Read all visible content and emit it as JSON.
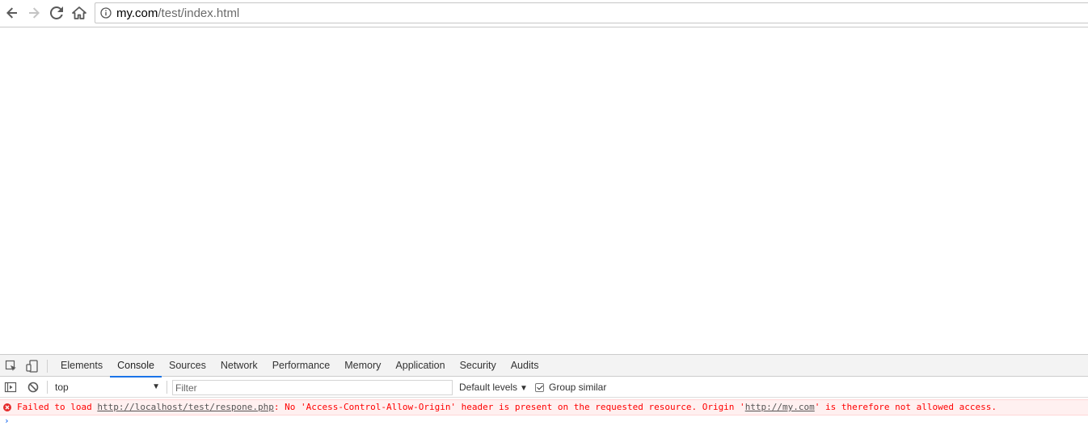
{
  "browser": {
    "url_host": "my.com",
    "url_path": "/test/index.html",
    "icons": [
      "back-arrow-icon",
      "forward-arrow-icon",
      "reload-icon",
      "home-icon",
      "info-icon"
    ]
  },
  "devtools": {
    "tabs": [
      "Elements",
      "Console",
      "Sources",
      "Network",
      "Performance",
      "Memory",
      "Application",
      "Security",
      "Audits"
    ],
    "active_tab": "Console",
    "accent_color": "#1a73e8",
    "console_toolbar": {
      "context": "top",
      "filter_placeholder": "Filter",
      "levels": "Default levels",
      "group_similar": "Group similar",
      "group_similar_checked": true
    },
    "error": {
      "prefix": "Failed to load ",
      "link": "http://localhost/test/respone.php",
      "middle": ": No 'Access-Control-Allow-Origin' header is present on the requested resource. Origin '",
      "origin_link": "http://my.com",
      "suffix": "' is therefore not allowed access.",
      "color": "#ff0000"
    }
  }
}
